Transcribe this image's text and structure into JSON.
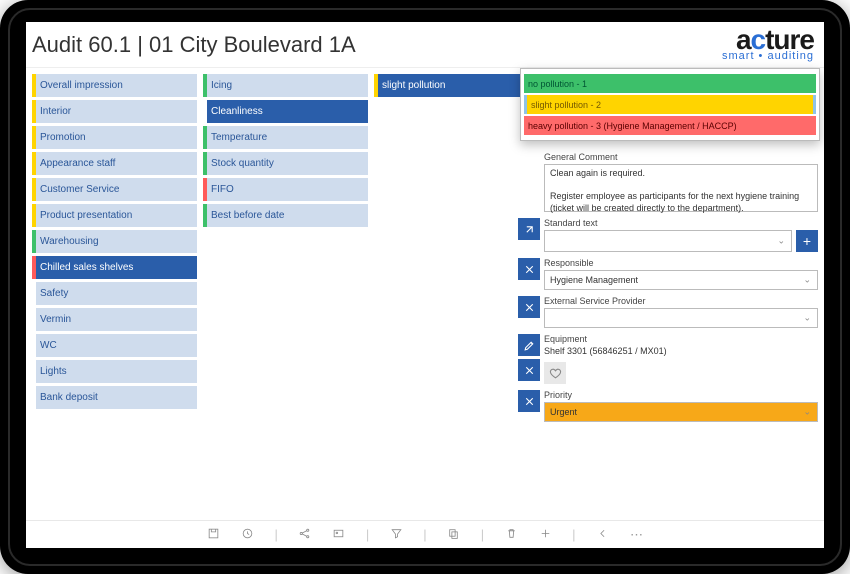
{
  "header": {
    "title": "Audit 60.1 | 01 City Boulevard 1A"
  },
  "logo": {
    "line1_prefix": "a",
    "line1_accent": "c",
    "line1_suffix": "ture",
    "line2": "smart • auditing"
  },
  "col1": [
    {
      "label": "Overall impression",
      "color": "y",
      "sel": false
    },
    {
      "label": "Interior",
      "color": "y",
      "sel": false
    },
    {
      "label": "Promotion",
      "color": "y",
      "sel": false
    },
    {
      "label": "Appearance staff",
      "color": "y",
      "sel": false
    },
    {
      "label": "Customer Service",
      "color": "y",
      "sel": false
    },
    {
      "label": "Product presentation",
      "color": "y",
      "sel": false
    },
    {
      "label": "Warehousing",
      "color": "g",
      "sel": false
    },
    {
      "label": "Chilled sales shelves",
      "color": "r",
      "sel": true
    },
    {
      "label": "Safety",
      "color": "bw",
      "sel": false
    },
    {
      "label": "Vermin",
      "color": "bw",
      "sel": false
    },
    {
      "label": "WC",
      "color": "bw",
      "sel": false
    },
    {
      "label": "Lights",
      "color": "bw",
      "sel": false
    },
    {
      "label": "Bank deposit",
      "color": "bw",
      "sel": false
    }
  ],
  "col2": [
    {
      "label": "Icing",
      "color": "g",
      "sel": false
    },
    {
      "label": "Cleanliness",
      "color": "bw",
      "sel": true
    },
    {
      "label": "Temperature",
      "color": "g",
      "sel": false
    },
    {
      "label": "Stock quantity",
      "color": "g",
      "sel": false
    },
    {
      "label": "FIFO",
      "color": "r",
      "sel": false
    },
    {
      "label": "Best before date",
      "color": "g",
      "sel": false
    }
  ],
  "col3": [
    {
      "label": "slight pollution",
      "color": "y"
    }
  ],
  "popup": {
    "options": [
      {
        "label": "no pollution - 1",
        "cls": "o1"
      },
      {
        "label": "slight pollution - 2",
        "cls": "o2"
      },
      {
        "label": "heavy pollution - 3  (Hygiene Management / HACCP)",
        "cls": "o3"
      }
    ]
  },
  "form": {
    "general_comment_label": "General Comment",
    "general_comment_value": "Clean again is required.\n\nRegister employee as participants for the next hygiene training (ticket will be created directly to the department).",
    "standard_text_label": "Standard text",
    "standard_text_value": "",
    "responsible_label": "Responsible",
    "responsible_value": "Hygiene Management",
    "esp_label": "External Service Provider",
    "esp_value": "",
    "equipment_label": "Equipment",
    "equipment_value": "Shelf 3301 (56846251 / MX01)",
    "priority_label": "Priority",
    "priority_value": "Urgent"
  }
}
